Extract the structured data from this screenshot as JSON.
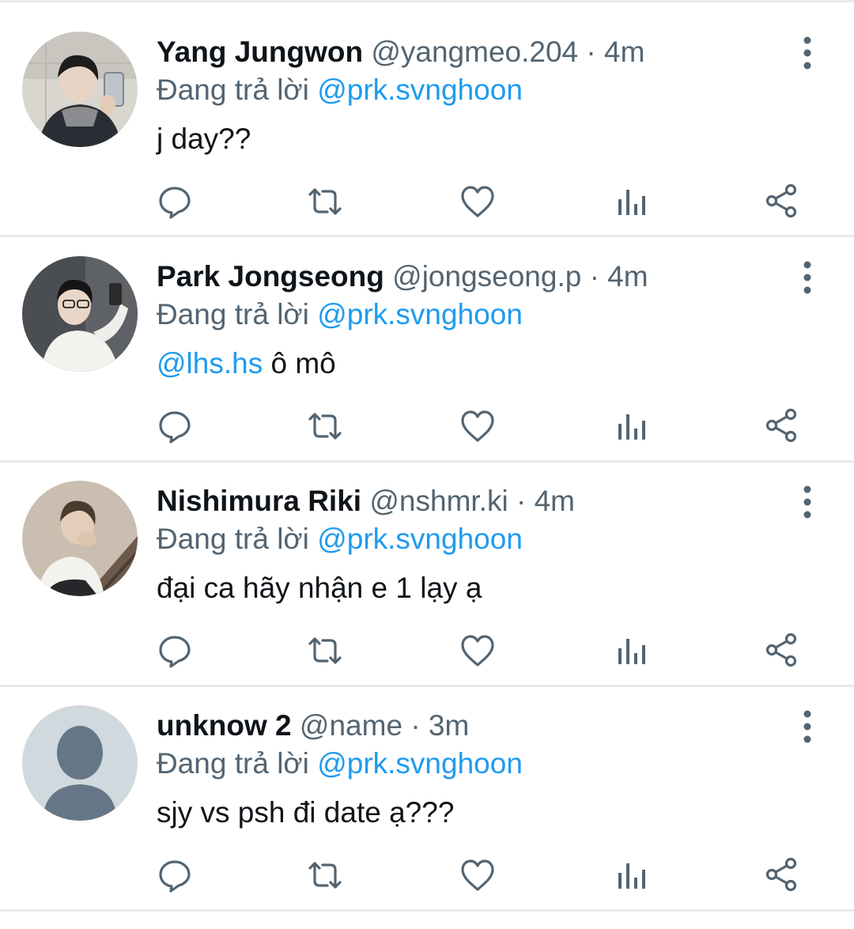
{
  "colors": {
    "text": "#0f1419",
    "secondary": "#536471",
    "mention": "#1d9bf0",
    "divider": "#e6e9ec",
    "icon": "#536471"
  },
  "labels": {
    "reply_prefix": "Đang trả lời",
    "replying_to": "@prk.svnghoon"
  },
  "tweets": [
    {
      "name": "Yang Jungwon",
      "handle": "@yangmeo.204",
      "separator": "·",
      "time": "4m",
      "mention": "",
      "text": "j day??",
      "avatar": "photo"
    },
    {
      "name": "Park Jongseong",
      "handle": "@jongseong.p",
      "separator": "·",
      "time": "4m",
      "mention": "@lhs.hs",
      "text": " ô mô",
      "avatar": "photo"
    },
    {
      "name": "Nishimura Riki",
      "handle": "@nshmr.ki",
      "separator": "·",
      "time": "4m",
      "mention": "",
      "text": "đại ca hãy nhận e 1 lạy ạ",
      "avatar": "photo"
    },
    {
      "name": "unknow 2",
      "handle": "@name",
      "separator": "·",
      "time": "3m",
      "mention": "",
      "text": "sjy vs psh đi date ạ???",
      "avatar": "default-avatar-icon"
    }
  ],
  "actions": [
    "reply-icon",
    "retweet-icon",
    "like-icon",
    "views-icon",
    "share-icon"
  ]
}
